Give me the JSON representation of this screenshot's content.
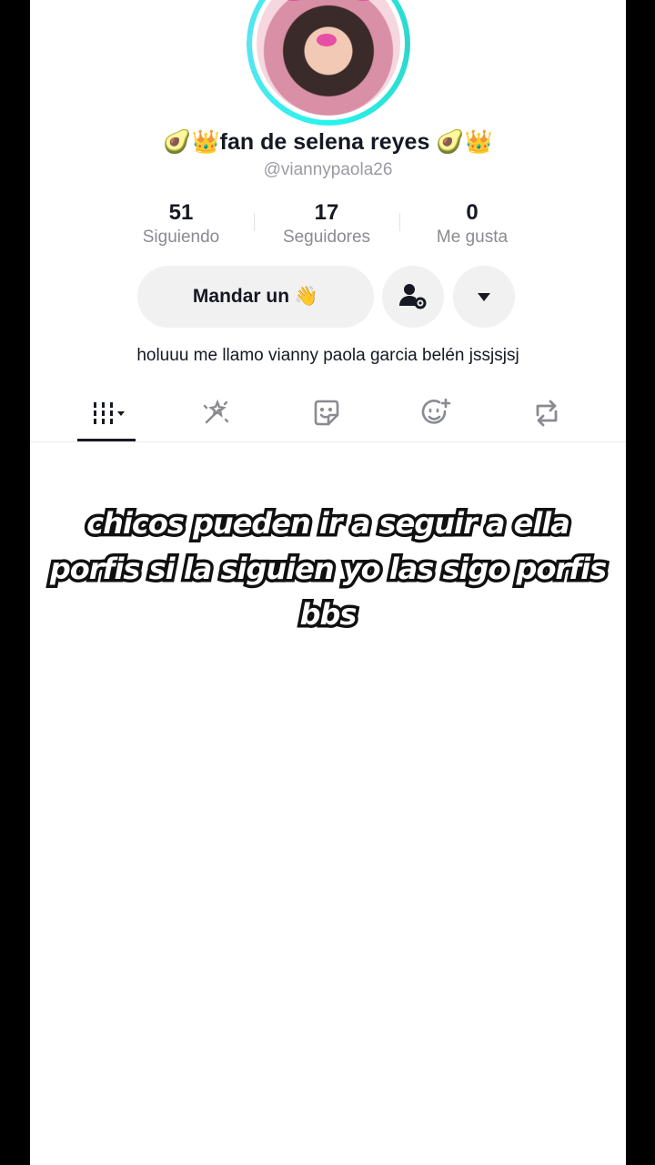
{
  "profile": {
    "display_name": "🥑👑fan de selena reyes 🥑👑",
    "handle": "@viannypaola26",
    "bio": "holuuu me llamo vianny paola garcia belén jssjsjsj"
  },
  "stats": [
    {
      "value": "51",
      "label": "Siguiendo"
    },
    {
      "value": "17",
      "label": "Seguidores"
    },
    {
      "value": "0",
      "label": "Me gusta"
    }
  ],
  "actions": {
    "message_label": "Mandar un 👋",
    "add_friend_icon": "user-gear-icon",
    "more_icon": "caret-down-icon"
  },
  "tabs": [
    {
      "icon": "videos-grid-icon",
      "active": true
    },
    {
      "icon": "sparkle-wand-icon",
      "active": false
    },
    {
      "icon": "sticker-icon",
      "active": false
    },
    {
      "icon": "face-sparkle-icon",
      "active": false
    },
    {
      "icon": "repost-icon",
      "active": false
    }
  ],
  "overlay": {
    "caption": "chicos pueden ir a seguir a ella porfis si la siguien yo las sigo porfis bbs"
  },
  "colors": {
    "accent_ring": "#25f4ee",
    "text_primary": "#161823",
    "text_secondary": "#8a8b91",
    "button_bg": "#f1f1f2"
  }
}
